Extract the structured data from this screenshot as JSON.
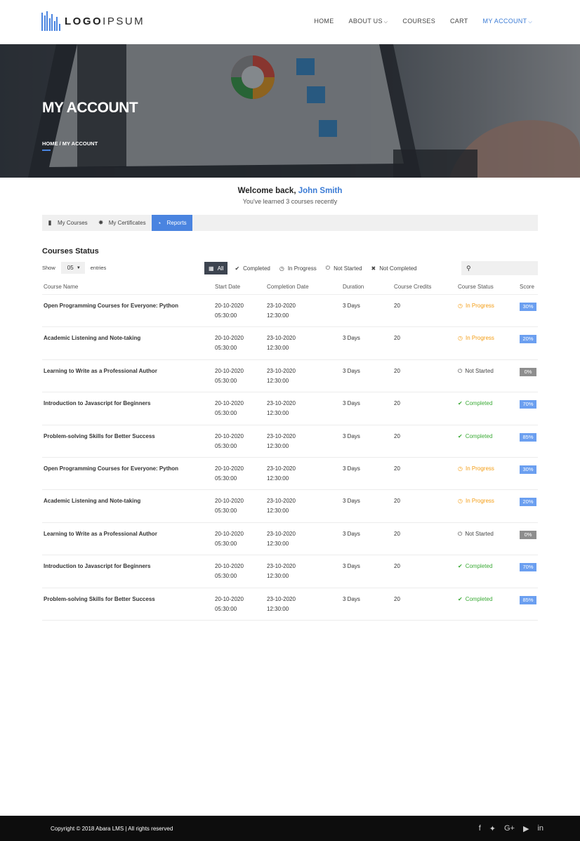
{
  "header": {
    "logo_bold": "LOGO",
    "logo_light": "IPSUM",
    "nav": [
      {
        "label": "HOME",
        "dropdown": false,
        "active": false
      },
      {
        "label": "ABOUT US",
        "dropdown": true,
        "active": false
      },
      {
        "label": "COURSES",
        "dropdown": false,
        "active": false
      },
      {
        "label": "CART",
        "dropdown": false,
        "active": false
      },
      {
        "label": "MY ACCOUNT",
        "dropdown": true,
        "active": true
      }
    ]
  },
  "hero": {
    "title": "MY ACCOUNT",
    "breadcrumb": "HOME / MY ACCOUNT"
  },
  "welcome": {
    "prefix": "Welcome back,",
    "name": "John Smith",
    "subtitle": "You've learned 3 courses recently"
  },
  "tabs": [
    {
      "label": "My Courses",
      "icon": "book-icon",
      "active": false
    },
    {
      "label": "My Certificates",
      "icon": "certificate-icon",
      "active": false
    },
    {
      "label": "Reports",
      "icon": "pie-chart-icon",
      "active": true
    }
  ],
  "section": {
    "title": "Courses Status",
    "show_label": "Show",
    "entries_value": "05",
    "entries_label": "entries"
  },
  "filters": [
    {
      "label": "All",
      "icon": "grid-icon",
      "active": true
    },
    {
      "label": "Completed",
      "icon": "check-circle-icon",
      "active": false
    },
    {
      "label": "In Progress",
      "icon": "clock-icon",
      "active": false
    },
    {
      "label": "Not Started",
      "icon": "power-icon",
      "active": false
    },
    {
      "label": "Not Completed",
      "icon": "times-circle-icon",
      "active": false
    }
  ],
  "search": {
    "placeholder": ""
  },
  "table": {
    "columns": [
      "Course Name",
      "Start Date",
      "Completion Date",
      "Duration",
      "Course Credits",
      "Course Status",
      "Score"
    ],
    "rows": [
      {
        "name": "Open Programming Courses for Everyone: Python",
        "start_date": "20-10-2020",
        "start_time": "05:30:00",
        "end_date": "23-10-2020",
        "end_time": "12:30:00",
        "duration": "3 Days",
        "credits": "20",
        "status": "In Progress",
        "score": "30%"
      },
      {
        "name": "Academic Listening and Note-taking",
        "start_date": "20-10-2020",
        "start_time": "05:30:00",
        "end_date": "23-10-2020",
        "end_time": "12:30:00",
        "duration": "3 Days",
        "credits": "20",
        "status": "In Progress",
        "score": "20%"
      },
      {
        "name": "Learning to Write as a Professional Author",
        "start_date": "20-10-2020",
        "start_time": "05:30:00",
        "end_date": "23-10-2020",
        "end_time": "12:30:00",
        "duration": "3 Days",
        "credits": "20",
        "status": "Not Started",
        "score": "0%"
      },
      {
        "name": "Introduction to Javascript for Beginners",
        "start_date": "20-10-2020",
        "start_time": "05:30:00",
        "end_date": "23-10-2020",
        "end_time": "12:30:00",
        "duration": "3 Days",
        "credits": "20",
        "status": "Completed",
        "score": "70%"
      },
      {
        "name": "Problem-solving Skills for Better Success",
        "start_date": "20-10-2020",
        "start_time": "05:30:00",
        "end_date": "23-10-2020",
        "end_time": "12:30:00",
        "duration": "3 Days",
        "credits": "20",
        "status": "Completed",
        "score": "85%"
      },
      {
        "name": "Open Programming Courses for Everyone: Python",
        "start_date": "20-10-2020",
        "start_time": "05:30:00",
        "end_date": "23-10-2020",
        "end_time": "12:30:00",
        "duration": "3 Days",
        "credits": "20",
        "status": "In Progress",
        "score": "30%"
      },
      {
        "name": "Academic Listening and Note-taking",
        "start_date": "20-10-2020",
        "start_time": "05:30:00",
        "end_date": "23-10-2020",
        "end_time": "12:30:00",
        "duration": "3 Days",
        "credits": "20",
        "status": "In Progress",
        "score": "20%"
      },
      {
        "name": "Learning to Write as a Professional Author",
        "start_date": "20-10-2020",
        "start_time": "05:30:00",
        "end_date": "23-10-2020",
        "end_time": "12:30:00",
        "duration": "3 Days",
        "credits": "20",
        "status": "Not Started",
        "score": "0%"
      },
      {
        "name": "Introduction to Javascript for Beginners",
        "start_date": "20-10-2020",
        "start_time": "05:30:00",
        "end_date": "23-10-2020",
        "end_time": "12:30:00",
        "duration": "3 Days",
        "credits": "20",
        "status": "Completed",
        "score": "70%"
      },
      {
        "name": "Problem-solving Skills for Better Success",
        "start_date": "20-10-2020",
        "start_time": "05:30:00",
        "end_date": "23-10-2020",
        "end_time": "12:30:00",
        "duration": "3 Days",
        "credits": "20",
        "status": "Completed",
        "score": "85%"
      }
    ]
  },
  "footer": {
    "copyright": "Copyright © 2018 Abara LMS | All rights reserved",
    "social": [
      "facebook-icon",
      "twitter-icon",
      "google-plus-icon",
      "youtube-icon",
      "linkedin-icon"
    ]
  },
  "colors": {
    "accent": "#4a84e0",
    "in_progress": "#f39c12",
    "completed": "#3aaa35",
    "score_blue": "#6b9ff0",
    "score_grey": "#8e8e8e",
    "footer_bg": "#0d0d0d"
  }
}
